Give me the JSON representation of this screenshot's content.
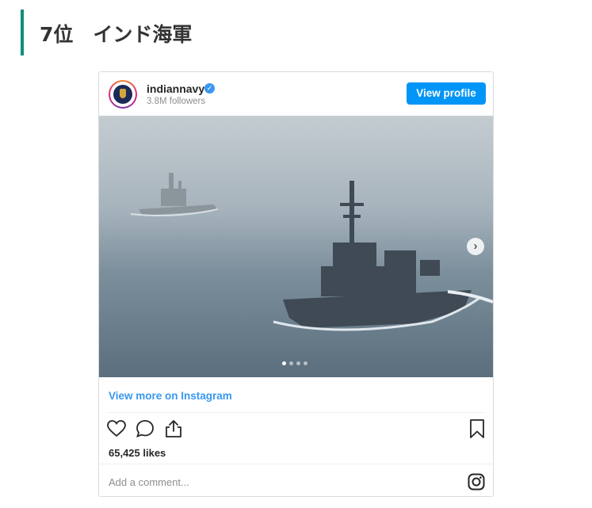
{
  "heading": {
    "text": "7位　インド海軍"
  },
  "post": {
    "username": "indiannavy",
    "verified_icon": "verified-badge-icon",
    "followers": "3.8M followers",
    "view_profile_label": "View profile",
    "view_more_label": "View more on Instagram",
    "likes": "65,425 likes",
    "comment_placeholder": "Add a comment...",
    "carousel": {
      "total_slides": 4,
      "active_slide": 1
    },
    "actions": [
      "heart-icon",
      "comment-icon",
      "share-icon",
      "bookmark-icon"
    ],
    "colors": {
      "accent": "#0095f6",
      "link": "#3897f0",
      "heading_bar": "#0e8f78"
    }
  }
}
